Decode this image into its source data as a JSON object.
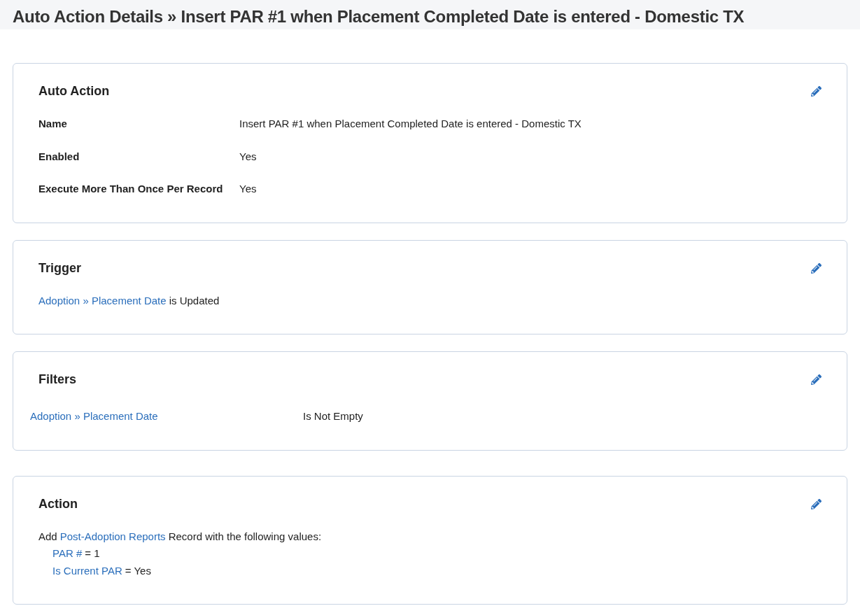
{
  "page_title": "Auto Action Details » Insert PAR #1 when Placement Completed Date is entered - Domestic TX",
  "auto_action": {
    "title": "Auto Action",
    "fields": [
      {
        "label": "Name",
        "value": "Insert PAR #1 when Placement Completed Date is entered - Domestic TX"
      },
      {
        "label": "Enabled",
        "value": "Yes"
      },
      {
        "label": "Execute More Than Once Per Record",
        "value": "Yes"
      }
    ]
  },
  "trigger": {
    "title": "Trigger",
    "link": "Adoption » Placement Date",
    "text": "is Updated"
  },
  "filters": {
    "title": "Filters",
    "rows": [
      {
        "field": "Adoption » Placement Date",
        "condition": "Is Not Empty"
      }
    ]
  },
  "action": {
    "title": "Action",
    "prefix": "Add",
    "link": "Post-Adoption Reports",
    "suffix": "Record with the following values:",
    "values": [
      {
        "field": "PAR #",
        "value": "= 1"
      },
      {
        "field": "Is Current PAR",
        "value": "= Yes"
      }
    ]
  }
}
